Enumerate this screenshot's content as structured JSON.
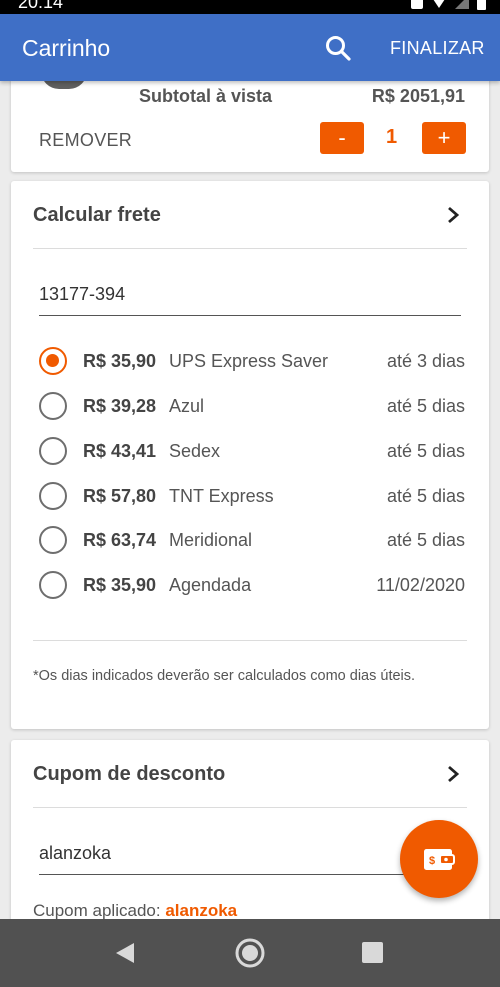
{
  "status_bar": {
    "time": "20:14"
  },
  "app_bar": {
    "title": "Carrinho",
    "search_icon": "search-icon",
    "finalize_label": "FINALIZAR"
  },
  "product": {
    "subtotal_label": "Subtotal à vista",
    "subtotal_value": "R$ 2051,91",
    "remove_label": "REMOVER",
    "quantity": "1",
    "minus_label": "-",
    "plus_label": "+"
  },
  "shipping": {
    "title": "Calcular frete",
    "cep_value": "13177-394",
    "selected_index": 0,
    "options": [
      {
        "price": "R$ 35,90",
        "carrier": "UPS Express Saver",
        "eta": "até 3 dias"
      },
      {
        "price": "R$ 39,28",
        "carrier": "Azul",
        "eta": "até 5 dias"
      },
      {
        "price": "R$ 43,41",
        "carrier": "Sedex",
        "eta": "até 5 dias"
      },
      {
        "price": "R$ 57,80",
        "carrier": "TNT Express",
        "eta": "até 5 dias"
      },
      {
        "price": "R$ 63,74",
        "carrier": "Meridional",
        "eta": "até 5 dias"
      },
      {
        "price": "R$ 35,90",
        "carrier": "Agendada",
        "eta": "11/02/2020"
      }
    ],
    "footnote": "*Os dias indicados deverão ser calculados como dias úteis."
  },
  "coupon": {
    "title": "Cupom de desconto",
    "input_value": "alanzoka",
    "applied_label": "Cupom aplicado:",
    "applied_code": "alanzoka"
  },
  "colors": {
    "app_bar": "#3f6fc6",
    "accent": "#f05a00"
  },
  "fab": {
    "icon": "wallet-money-icon"
  }
}
